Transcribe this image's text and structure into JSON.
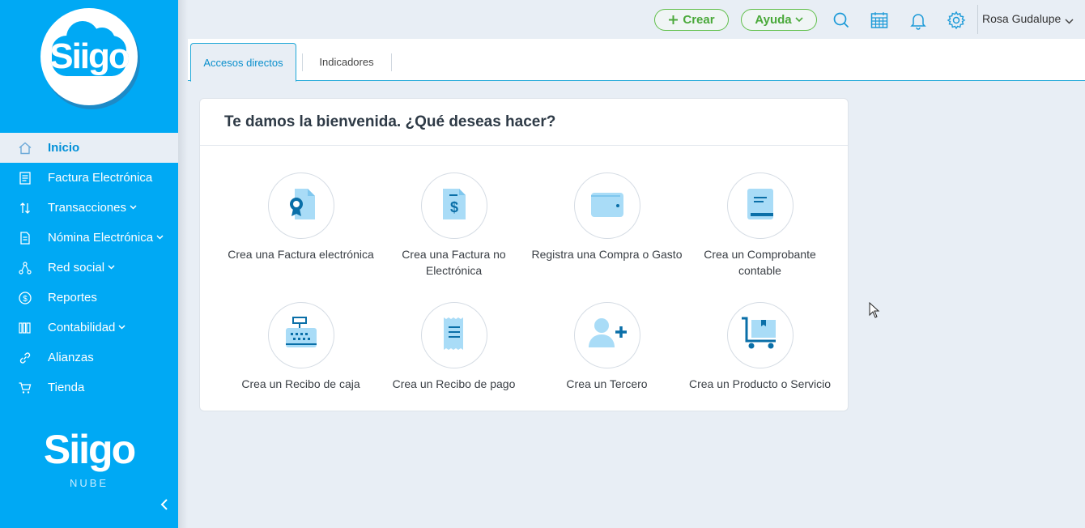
{
  "sidebar": {
    "logo_text": "Siigo",
    "items": [
      {
        "label": "Inicio",
        "icon": "home-icon",
        "active": true,
        "has_chevron": false
      },
      {
        "label": "Factura Electrónica",
        "icon": "invoice-icon",
        "active": false,
        "has_chevron": false
      },
      {
        "label": "Transacciones",
        "icon": "transactions-icon",
        "active": false,
        "has_chevron": true
      },
      {
        "label": "Nómina Electrónica",
        "icon": "payroll-icon",
        "active": false,
        "has_chevron": true
      },
      {
        "label": "Red social",
        "icon": "network-icon",
        "active": false,
        "has_chevron": true
      },
      {
        "label": "Reportes",
        "icon": "reports-icon",
        "active": false,
        "has_chevron": false
      },
      {
        "label": "Contabilidad",
        "icon": "accounting-icon",
        "active": false,
        "has_chevron": true
      },
      {
        "label": "Alianzas",
        "icon": "link-icon",
        "active": false,
        "has_chevron": false
      },
      {
        "label": "Tienda",
        "icon": "cart-icon",
        "active": false,
        "has_chevron": false
      }
    ],
    "bottom_logo": {
      "brand": "Siigo",
      "sub": "NUBE"
    }
  },
  "topbar": {
    "create_label": "Crear",
    "help_label": "Ayuda",
    "user_name": "Rosa Gudalupe"
  },
  "tabs": [
    {
      "label": "Accesos directos",
      "active": true
    },
    {
      "label": "Indicadores",
      "active": false
    }
  ],
  "welcome": {
    "title": "Te damos la bienvenida. ¿Qué deseas hacer?",
    "actions": [
      {
        "label": "Crea una Factura electrónica",
        "icon": "e-invoice-icon"
      },
      {
        "label": "Crea una Factura no Electrónica",
        "icon": "invoice-dollar-icon"
      },
      {
        "label": "Registra una Compra o Gasto",
        "icon": "wallet-icon"
      },
      {
        "label": "Crea un Comprobante contable",
        "icon": "ledger-book-icon"
      },
      {
        "label": "Crea un Recibo de caja",
        "icon": "cash-register-icon"
      },
      {
        "label": "Crea un Recibo de pago",
        "icon": "receipt-icon"
      },
      {
        "label": "Crea un Tercero",
        "icon": "add-user-icon"
      },
      {
        "label": "Crea un Producto o Servicio",
        "icon": "product-cart-icon"
      }
    ]
  },
  "colors": {
    "sidebar": "#00a9f4",
    "accent": "#0a8fcc",
    "success": "#4aa93a",
    "background": "#e8eef5"
  }
}
